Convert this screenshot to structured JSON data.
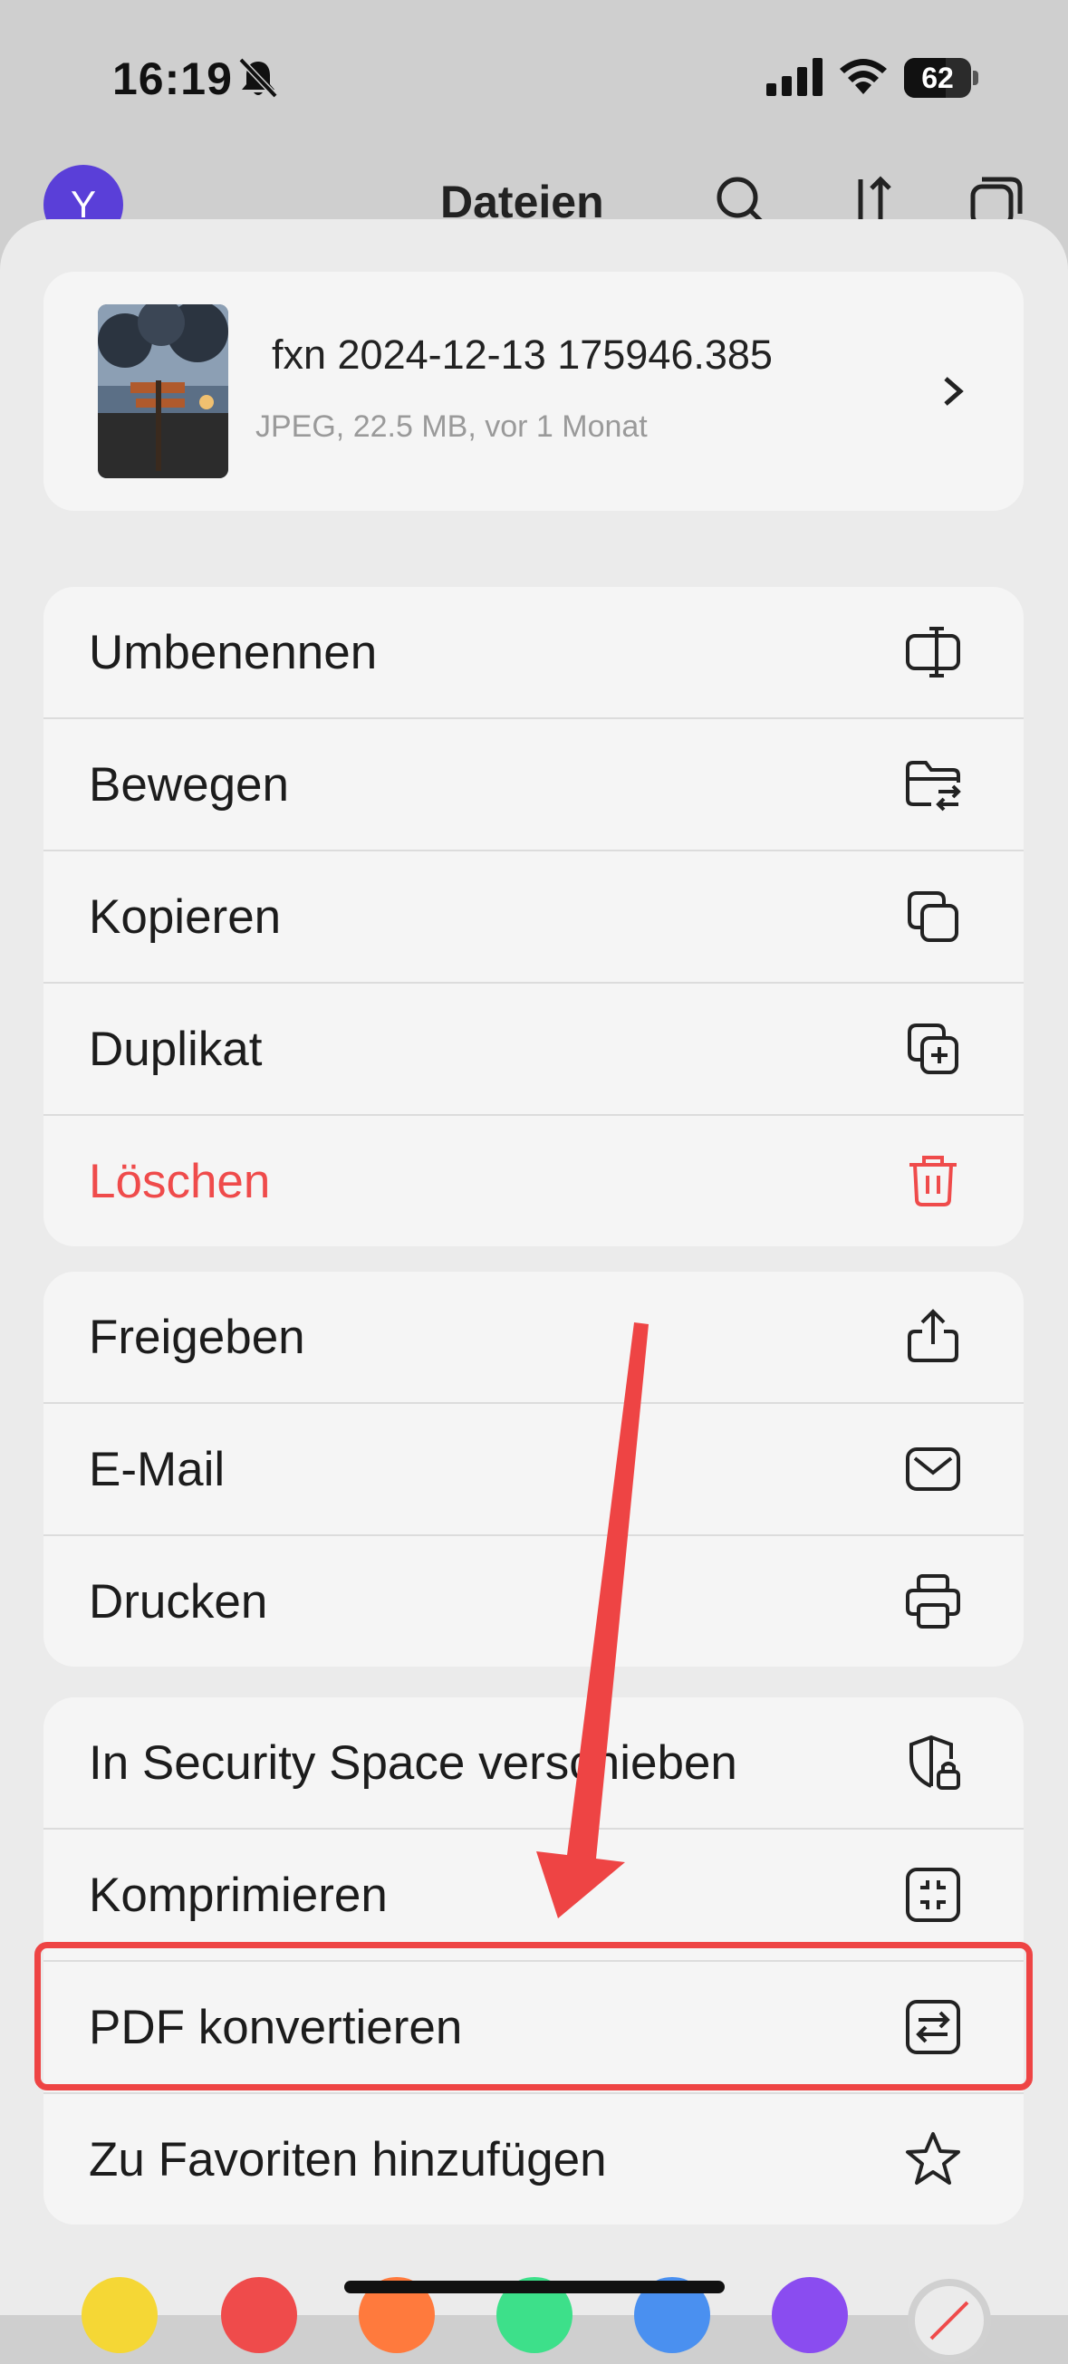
{
  "status_bar": {
    "time": "16:19",
    "battery_level": "62",
    "icons": [
      "bell-slash-icon",
      "cellular-signal-icon",
      "wifi-icon",
      "battery-icon"
    ]
  },
  "background_header": {
    "avatar_initial": "Y",
    "title": "Dateien",
    "avatar_color": "#5a3fd8"
  },
  "file": {
    "name": "fxn 2024-12-13 175946.385",
    "meta": "JPEG, 22.5 MB, vor 1 Monat"
  },
  "menu": {
    "group1": [
      {
        "label": "Umbenennen",
        "icon": "rename-icon"
      },
      {
        "label": "Bewegen",
        "icon": "move-folder-icon"
      },
      {
        "label": "Kopieren",
        "icon": "copy-icon"
      },
      {
        "label": "Duplikat",
        "icon": "duplicate-icon"
      },
      {
        "label": "Löschen",
        "icon": "trash-icon",
        "color": "#ef4b4b"
      }
    ],
    "group2": [
      {
        "label": "Freigeben",
        "icon": "share-icon"
      },
      {
        "label": "E-Mail",
        "icon": "mail-icon"
      },
      {
        "label": "Drucken",
        "icon": "print-icon"
      }
    ],
    "group3": [
      {
        "label": "In Security Space verschieben",
        "icon": "shield-lock-icon"
      },
      {
        "label": "Komprimieren",
        "icon": "compress-icon"
      },
      {
        "label": "PDF konvertieren",
        "icon": "convert-icon"
      },
      {
        "label": "Zu Favoriten hinzufügen",
        "icon": "star-icon"
      }
    ]
  },
  "color_tags": [
    "#f5d735",
    "#ef4b4b",
    "#ff7a3d",
    "#3de08a",
    "#4a90f0",
    "#8a4cf0"
  ],
  "annotation": {
    "color": "#ee4444"
  }
}
